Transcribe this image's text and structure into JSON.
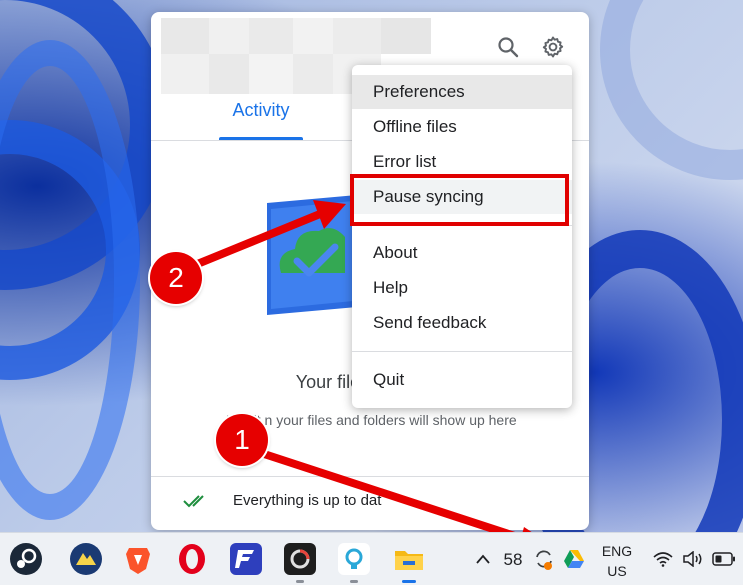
{
  "menu": {
    "items": [
      {
        "label": "Preferences"
      },
      {
        "label": "Offline files"
      },
      {
        "label": "Error list"
      },
      {
        "label": "Pause syncing"
      },
      {
        "label": "About"
      },
      {
        "label": "Help"
      },
      {
        "label": "Send feedback"
      },
      {
        "label": "Quit"
      }
    ]
  },
  "panel": {
    "tab_activity": "Activity",
    "empty_title": "Your files a",
    "empty_sub": "Activit  n your files and folders will show up here",
    "footer_text": "Everything is up to dat"
  },
  "annotations": {
    "step1": "1",
    "step2": "2"
  },
  "taskbar": {
    "apps": [
      "steam-icon",
      "mullvad-icon",
      "brave-icon",
      "opera-icon",
      "fastmail-icon",
      "app-icon",
      "toolbox-icon",
      "file-explorer-icon"
    ],
    "tray_count": "58",
    "lang_top": "ENG",
    "lang_bottom": "US"
  },
  "colors": {
    "accent": "#1a73e8",
    "annotation_red": "#e60000"
  }
}
